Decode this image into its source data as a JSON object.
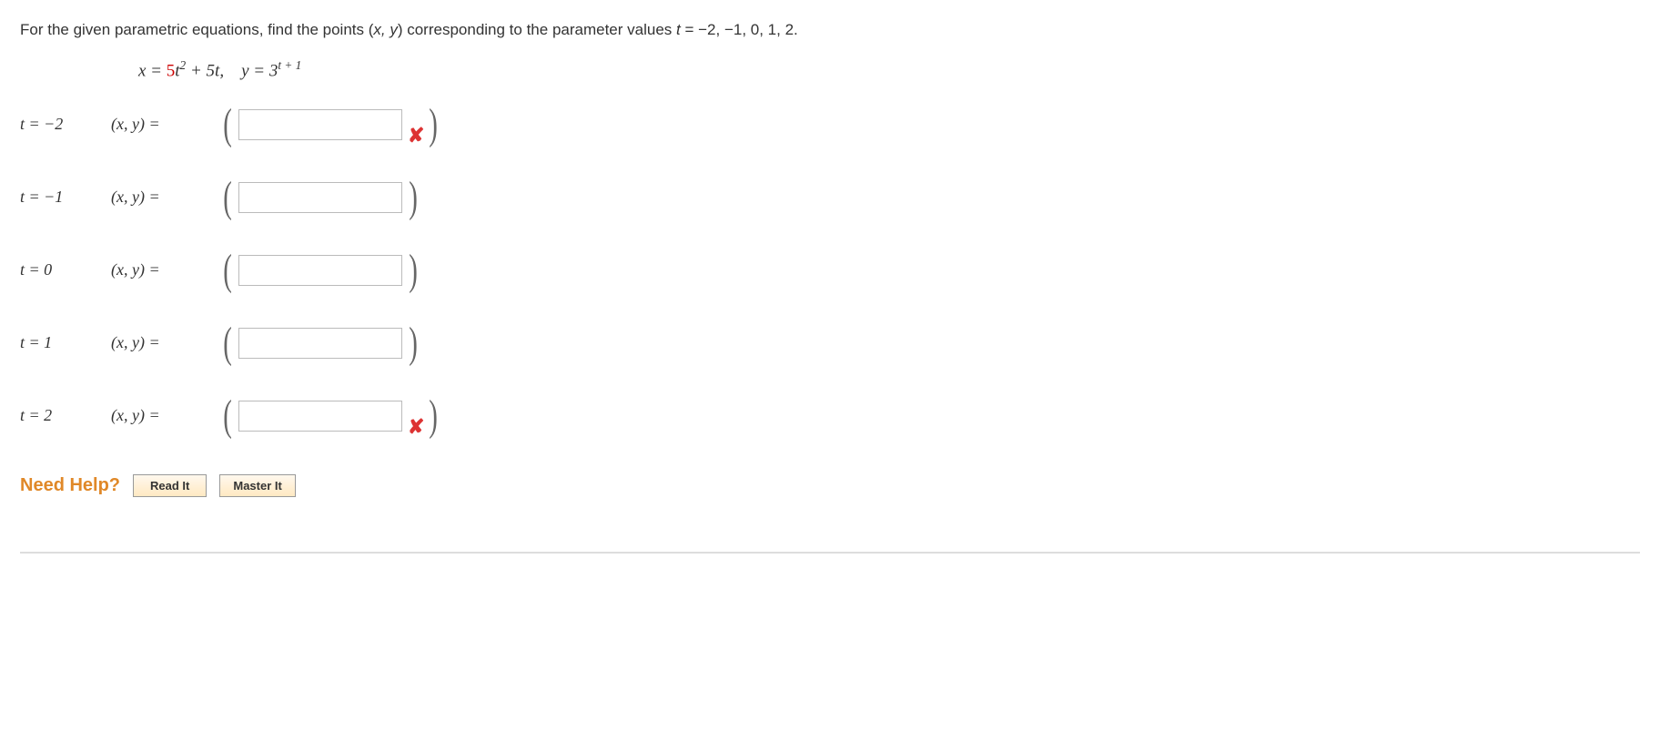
{
  "prompt_pre": "For the given parametric equations, find the points (",
  "prompt_xy": "x, y",
  "prompt_mid": ") corresponding to the parameter values ",
  "prompt_t": "t",
  "prompt_vals": " = −2, −1, 0, 1, 2.",
  "eq": {
    "x_lhs": "x = ",
    "coef": "5",
    "t": "t",
    "sq": "2",
    "plus": " + 5",
    "t2": "t",
    "comma": ",    ",
    "y_lhs": "y = 3",
    "exp_t": "t",
    "exp_plus": " + 1"
  },
  "rows": [
    {
      "t": "t = −2",
      "xy": "(x, y)  =",
      "wrong": true
    },
    {
      "t": "t = −1",
      "xy": "(x, y)  =",
      "wrong": false
    },
    {
      "t": "t = 0",
      "xy": "(x, y)  =",
      "wrong": false
    },
    {
      "t": "t = 1",
      "xy": "(x, y)  =",
      "wrong": false
    },
    {
      "t": "t = 2",
      "xy": "(x, y)  =",
      "wrong": true
    }
  ],
  "help": {
    "label": "Need Help?",
    "read": "Read It",
    "master": "Master It"
  }
}
